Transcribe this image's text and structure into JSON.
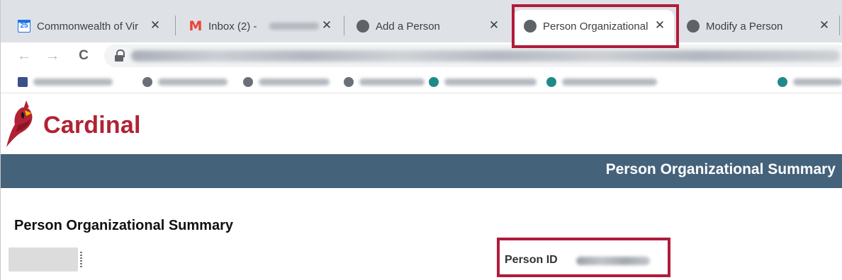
{
  "browser": {
    "tabs": [
      {
        "label": "Commonwealth of Vir",
        "favicon": "calendar-icon",
        "favicon_text": "25",
        "active": false
      },
      {
        "label": "Inbox (2) -",
        "favicon": "gmail-icon",
        "favicon_text": "M",
        "active": false
      },
      {
        "label": "Add a Person",
        "favicon": "globe-icon",
        "active": false
      },
      {
        "label": "Person Organizational",
        "favicon": "globe-icon",
        "active": true
      },
      {
        "label": "Modify a Person",
        "favicon": "globe-icon",
        "active": false
      }
    ],
    "close_glyph": "✕",
    "back_glyph": "←",
    "forward_glyph": "→",
    "reload_glyph": "C"
  },
  "app": {
    "logo_text": "Cardinal",
    "banner_title": "Person Organizational Summary",
    "page_title": "Person Organizational Summary",
    "person_id_label": "Person ID"
  },
  "colors": {
    "brand_red": "#b22234",
    "banner_bg": "#44627a",
    "highlight": "#b11b3a"
  }
}
